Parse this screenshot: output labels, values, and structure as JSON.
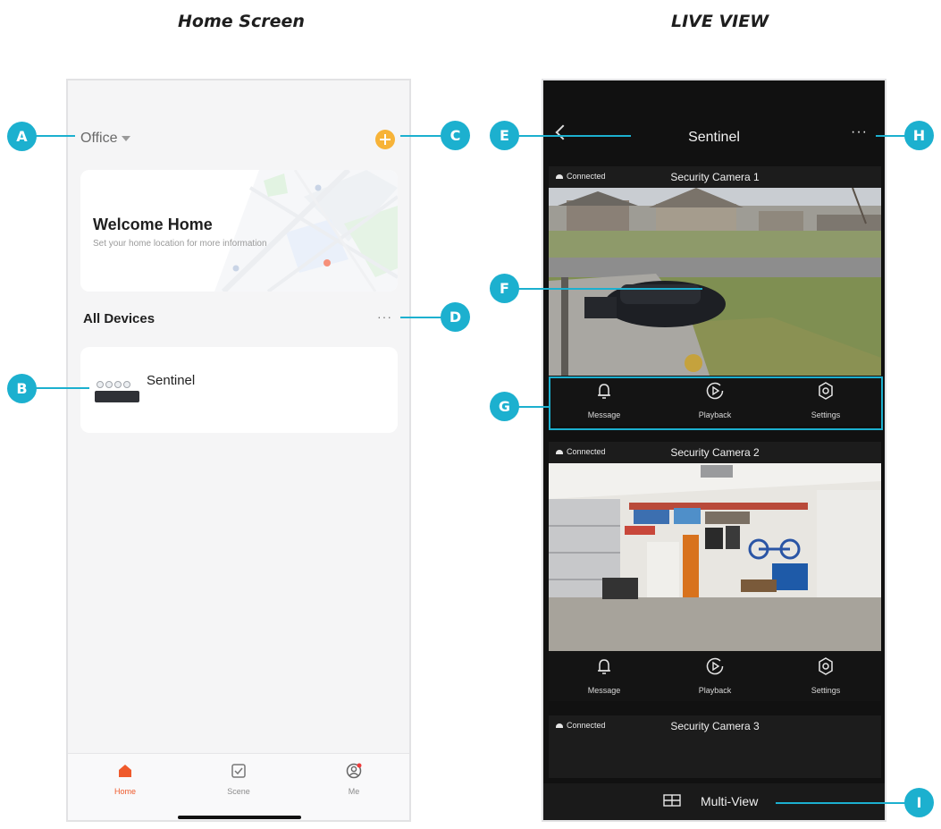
{
  "panels": {
    "home_title": "Home Screen",
    "live_title": "LIVE VIEW"
  },
  "home": {
    "location": "Office",
    "welcome_title": "Welcome Home",
    "welcome_subtitle": "Set your home location for more information",
    "devices_heading": "All Devices",
    "more_glyph": "···",
    "device_name": "Sentinel",
    "tabs": [
      {
        "label": "Home",
        "icon": "home-icon",
        "active": true
      },
      {
        "label": "Scene",
        "icon": "checkbox-icon"
      },
      {
        "label": "Me",
        "icon": "profile-icon"
      }
    ],
    "accent": "#ef5a2c",
    "add_color": "#f7b338"
  },
  "live": {
    "title": "Sentinel",
    "more_glyph": "···",
    "cameras": [
      {
        "status": "Connected",
        "name": "Security Camera 1"
      },
      {
        "status": "Connected",
        "name": "Security Camera 2"
      },
      {
        "status": "Connected",
        "name": "Security Camera 3"
      }
    ],
    "actions": [
      "Message",
      "Playback",
      "Settings"
    ],
    "multiview_label": "Multi-View"
  },
  "callouts": [
    "A",
    "B",
    "C",
    "D",
    "E",
    "F",
    "G",
    "H",
    "I"
  ],
  "callout_color": "#1cb0cf"
}
